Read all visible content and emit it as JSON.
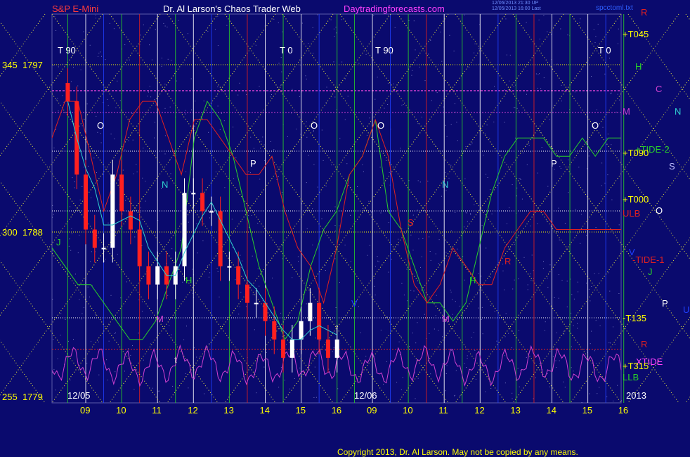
{
  "colors": {
    "background": "#0a0a6e",
    "title_red": "#ff3b3b",
    "title_white": "#ffffff",
    "title_magenta": "#ff40ff",
    "axis_yellow": "#ffff00",
    "planet_line_yellow": "#e8e840",
    "green": "#29d029",
    "magenta": "#d040d0",
    "red": "#e02020",
    "cyan": "#2fd0d0",
    "white": "#ffffff"
  },
  "header": {
    "instrument": "S&P E-Mini",
    "author": "Dr. Al Larson's Chaos Trader Web",
    "site": "Daytradingforecasts.com",
    "timestamp1": "12/06/2013 21:30 UP",
    "timestamp2": "12/05/2013 16:00 Last",
    "file": "spcctoml.txt"
  },
  "footer": {
    "copyright": "Copyright 2013, Dr. Al Larson. May not be copied by any means."
  },
  "chart_data": {
    "type": "line",
    "title": "S&P E-Mini",
    "xlabel": "",
    "ylabel": "",
    "ylim": [
      1779,
      1797
    ],
    "y_ticks": [
      {
        "angle": "345",
        "price": "1797",
        "value": 1797
      },
      {
        "angle": "300",
        "price": "1788",
        "value": 1788
      },
      {
        "angle": "255",
        "price": "1779",
        "value": 1779
      }
    ],
    "x_ticks": [
      "09",
      "10",
      "11",
      "12",
      "13",
      "14",
      "15",
      "16",
      "09",
      "10",
      "11",
      "12",
      "13",
      "14",
      "15",
      "16"
    ],
    "date_labels": [
      "12/05",
      "12/06"
    ],
    "year_label": "2013",
    "time_markers": [
      "T 90",
      "T 0",
      "T 90",
      "T 0"
    ],
    "right_axis_labels": [
      {
        "text": "R",
        "color": "#e02020"
      },
      {
        "text": "+T045",
        "color": "#ffff00"
      },
      {
        "text": "H",
        "color": "#29d029"
      },
      {
        "text": "C",
        "color": "#d040d0"
      },
      {
        "text": "N",
        "color": "#2fd0d0"
      },
      {
        "text": "M",
        "color": "#d040d0"
      },
      {
        "text": "+TIDE-2",
        "color": "#29d029"
      },
      {
        "text": "+T090",
        "color": "#ffff00"
      },
      {
        "text": "S",
        "color": "#c0c0ff"
      },
      {
        "text": "+T000",
        "color": "#ffff00"
      },
      {
        "text": "ULB",
        "color": "#e02020"
      },
      {
        "text": "O",
        "color": "#ffffff"
      },
      {
        "text": "V",
        "color": "#2040ff"
      },
      {
        "text": "-TIDE-1",
        "color": "#e02020"
      },
      {
        "text": "J",
        "color": "#29d029"
      },
      {
        "text": "P",
        "color": "#ffffff"
      },
      {
        "text": "U",
        "color": "#2040ff"
      },
      {
        "text": "-T135",
        "color": "#ffff00"
      },
      {
        "text": "R",
        "color": "#e02020"
      },
      {
        "text": "XTIDE",
        "color": "#ff40ff"
      },
      {
        "text": "+T315",
        "color": "#ffff00"
      },
      {
        "text": "LLB",
        "color": "#29d029"
      }
    ],
    "in_chart_labels": [
      {
        "text": "O",
        "color": "#ffffff"
      },
      {
        "text": "O",
        "color": "#ffffff"
      },
      {
        "text": "O",
        "color": "#ffffff"
      },
      {
        "text": "O",
        "color": "#ffffff"
      },
      {
        "text": "P",
        "color": "#ffffff"
      },
      {
        "text": "P",
        "color": "#ffffff"
      },
      {
        "text": "N",
        "color": "#2fd0d0"
      },
      {
        "text": "N",
        "color": "#2fd0d0"
      },
      {
        "text": "S",
        "color": "#e02020"
      },
      {
        "text": "H",
        "color": "#29d029"
      },
      {
        "text": "H",
        "color": "#29d029"
      },
      {
        "text": "M",
        "color": "#d040d0"
      },
      {
        "text": "M",
        "color": "#d040d0"
      },
      {
        "text": "J",
        "color": "#29d029"
      },
      {
        "text": "t",
        "color": "#c0c0c0"
      },
      {
        "text": "V",
        "color": "#2040ff"
      },
      {
        "text": "R",
        "color": "#e02020"
      }
    ],
    "series": [
      {
        "type": "candlestick",
        "session": "12/05",
        "x": [
          8.5,
          8.75,
          9.0,
          9.25,
          9.5,
          9.75,
          10.0,
          10.25,
          10.5,
          10.75,
          11.0,
          11.25,
          11.5,
          11.75,
          12.0,
          12.25,
          12.5,
          12.75,
          13.0,
          13.25,
          13.5,
          13.75,
          14.0,
          14.25,
          14.5,
          14.75,
          15.0,
          15.25,
          15.5,
          15.75,
          16.0
        ],
        "close": [
          1795,
          1791,
          1788,
          1787,
          1787,
          1791,
          1789,
          1788,
          1786,
          1785,
          1786,
          1785,
          1786,
          1790,
          1790,
          1789,
          1789,
          1786,
          1786,
          1785,
          1784,
          1784,
          1783,
          1782,
          1781,
          1782,
          1783,
          1784,
          1782,
          1781,
          1782
        ]
      },
      {
        "type": "line",
        "color": "#29d029",
        "y": [
          1787,
          1786,
          1785,
          1785,
          1784,
          1783,
          1782,
          1782,
          1783,
          1785,
          1787,
          1793,
          1795,
          1794,
          1792,
          1789,
          1786,
          1784,
          1782,
          1783,
          1786,
          1788,
          1789,
          1791,
          1792,
          1794,
          1789,
          1788,
          1786,
          1784,
          1784,
          1783,
          1784,
          1787,
          1790,
          1792,
          1793,
          1793,
          1793,
          1792,
          1792,
          1793,
          1792,
          1793,
          1793
        ]
      },
      {
        "type": "line",
        "color": "#e02020",
        "y": [
          1793,
          1795,
          1795,
          1792,
          1789,
          1791,
          1794,
          1795,
          1795,
          1793,
          1791,
          1794,
          1794,
          1793,
          1792,
          1791,
          1791,
          1792,
          1789,
          1787,
          1786,
          1784,
          1787,
          1791,
          1792,
          1794,
          1792,
          1788,
          1785,
          1784,
          1785,
          1787,
          1786,
          1785,
          1785,
          1787,
          1788,
          1789,
          1789,
          1788,
          1788,
          1788,
          1788,
          1788,
          1788
        ]
      },
      {
        "type": "line",
        "color": "#d040d0",
        "name": "XTIDE"
      }
    ]
  }
}
